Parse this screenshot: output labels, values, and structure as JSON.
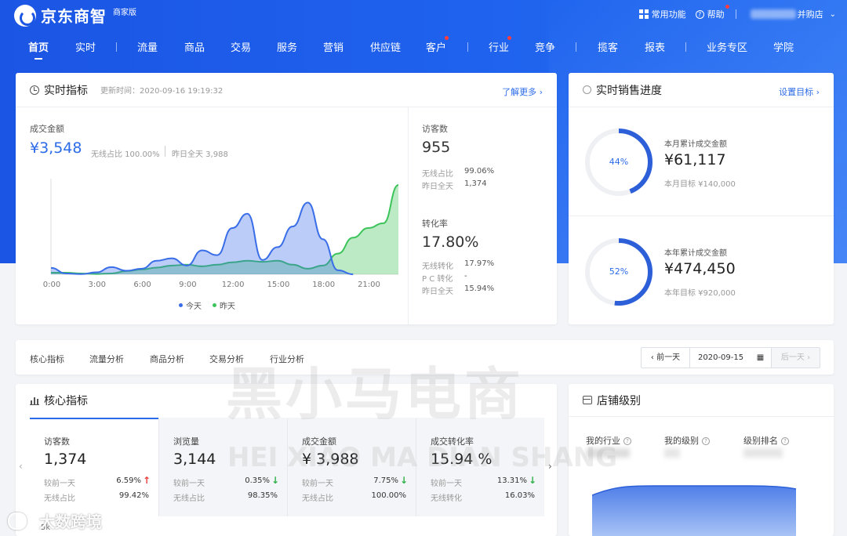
{
  "brand": {
    "name": "京东商智",
    "edition": "商家版"
  },
  "topbar": {
    "common_functions": "常用功能",
    "help": "帮助",
    "shop_suffix": "并购店"
  },
  "nav": [
    "首页",
    "实时",
    "流量",
    "商品",
    "交易",
    "服务",
    "营销",
    "供应链",
    "客户",
    "行业",
    "竞争",
    "揽客",
    "报表",
    "业务专区",
    "学院"
  ],
  "realtime": {
    "title": "实时指标",
    "update_label": "更新时间：2020-09-16 19:19:32",
    "more_link": "了解更多 ›",
    "gmv_label": "成交金额",
    "gmv_value": "¥3,548",
    "wireless_ratio": "无线占比 100.00%",
    "yesterday_total": "昨日全天 3,988",
    "x_ticks": [
      "0:00",
      "3:00",
      "6:00",
      "9:00",
      "12:00",
      "15:00",
      "18:00",
      "21:00"
    ],
    "legend_today": "今天",
    "legend_yesterday": "昨天",
    "visitors_label": "访客数",
    "visitors_value": "955",
    "visitors_wireless_label": "无线占比",
    "visitors_wireless_value": "99.06%",
    "visitors_yesterday_label": "昨日全天",
    "visitors_yesterday_value": "1,374",
    "conv_label": "转化率",
    "conv_value": "17.80%",
    "conv_wireless_label": "无线转化",
    "conv_wireless_value": "17.97%",
    "conv_pc_label": "P C 转化",
    "conv_pc_value": "-",
    "conv_yesterday_label": "昨日全天",
    "conv_yesterday_value": "15.94%"
  },
  "chart_data": {
    "type": "area",
    "categories": [
      "0:00",
      "3:00",
      "6:00",
      "9:00",
      "12:00",
      "15:00",
      "18:00",
      "21:00"
    ],
    "series": [
      {
        "name": "今天",
        "color": "#3a6ee8",
        "values": [
          40,
          5,
          1,
          12,
          45,
          22,
          35,
          85,
          100,
          55,
          150,
          120,
          290,
          380,
          90,
          170,
          300,
          450,
          220,
          25,
          0,
          null,
          null,
          null
        ]
      },
      {
        "name": "昨天",
        "color": "#3cc45a",
        "values": [
          10,
          10,
          5,
          2,
          5,
          20,
          30,
          42,
          55,
          60,
          50,
          60,
          75,
          85,
          78,
          85,
          60,
          35,
          55,
          130,
          230,
          290,
          320,
          560
        ]
      }
    ]
  },
  "sales_progress": {
    "title": "实时销售进度",
    "set_target": "设置目标 ›",
    "month": {
      "percent": 44,
      "percent_label": "44%",
      "label": "本月累计成交金额",
      "value": "¥61,117",
      "target": "本月目标 ¥140,000"
    },
    "year": {
      "percent": 52,
      "percent_label": "52%",
      "label": "本年累计成交金额",
      "value": "¥474,450",
      "target": "本年目标 ¥920,000"
    }
  },
  "tabs": [
    "核心指标",
    "流量分析",
    "商品分析",
    "交易分析",
    "行业分析"
  ],
  "date_picker": {
    "prev": "‹ 前一天",
    "date": "2020-09-15",
    "next": "后一天 ›"
  },
  "core": {
    "title": "核心指标",
    "metrics": [
      {
        "label": "访客数",
        "value": "1,374",
        "cmp_label": "较前一天",
        "cmp_value": "6.59%",
        "arrow": "↑",
        "dir": "up",
        "sub_label": "无线占比",
        "sub_value": "99.42%"
      },
      {
        "label": "浏览量",
        "value": "3,144",
        "cmp_label": "较前一天",
        "cmp_value": "0.35%",
        "arrow": "↓",
        "dir": "down",
        "sub_label": "无线占比",
        "sub_value": "98.35%"
      },
      {
        "label": "成交金额",
        "value": "¥ 3,988",
        "cmp_label": "较前一天",
        "cmp_value": "7.75%",
        "arrow": "↓",
        "dir": "down",
        "sub_label": "无线占比",
        "sub_value": "100.00%"
      },
      {
        "label": "成交转化率",
        "value": "15.94 %",
        "cmp_label": "较前一天",
        "cmp_value": "13.31%",
        "arrow": "↓",
        "dir": "down",
        "sub_label": "无线转化",
        "sub_value": "16.03%"
      }
    ],
    "axis_label": "5k"
  },
  "store_level": {
    "title": "店铺级别",
    "cols": [
      "我的行业",
      "我的级别",
      "级别排名"
    ]
  },
  "watermark": {
    "cn": "黑小马电商",
    "en": "HEI XIAO MA DIAN SHANG",
    "corner": "大数跨境"
  }
}
